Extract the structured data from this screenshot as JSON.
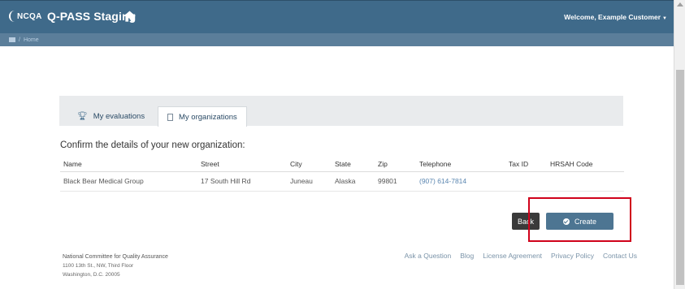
{
  "header": {
    "logo_text": "NCQA",
    "app_title": "Q-PASS Staging",
    "welcome": "Welcome, Example Customer"
  },
  "breadcrumb": {
    "separator": "/",
    "current": "Home"
  },
  "tabs": [
    {
      "label": "My evaluations",
      "icon": "trophy-icon"
    },
    {
      "label": "My organizations",
      "icon": "document-icon",
      "active": true
    }
  ],
  "main": {
    "instruction": "Confirm the details of your new organization:"
  },
  "table": {
    "columns": [
      "Name",
      "Street",
      "City",
      "State",
      "Zip",
      "Telephone",
      "Tax ID",
      "HRSAH Code"
    ],
    "rows": [
      [
        "Black Bear Medical Group",
        "17 South Hill Rd",
        "Juneau",
        "Alaska",
        "99801",
        "(907) 614-7814",
        "",
        ""
      ]
    ]
  },
  "actions": {
    "back_label": "Back",
    "create_label": "Create"
  },
  "footer": {
    "org_name": "National Committee for Quality Assurance",
    "address_line1": "1100 13th St., NW, Third Floor",
    "address_line2": "Washington, D.C. 20005",
    "links": [
      "Ask a Question",
      "Blog",
      "License Agreement",
      "Privacy Policy",
      "Contact Us"
    ]
  },
  "colors": {
    "navbar": "#3f6a8a",
    "breadcrumb": "#5b7e9a",
    "create_button": "#4d7592",
    "back_button": "#3a3a3a",
    "highlight": "#d0021b"
  }
}
